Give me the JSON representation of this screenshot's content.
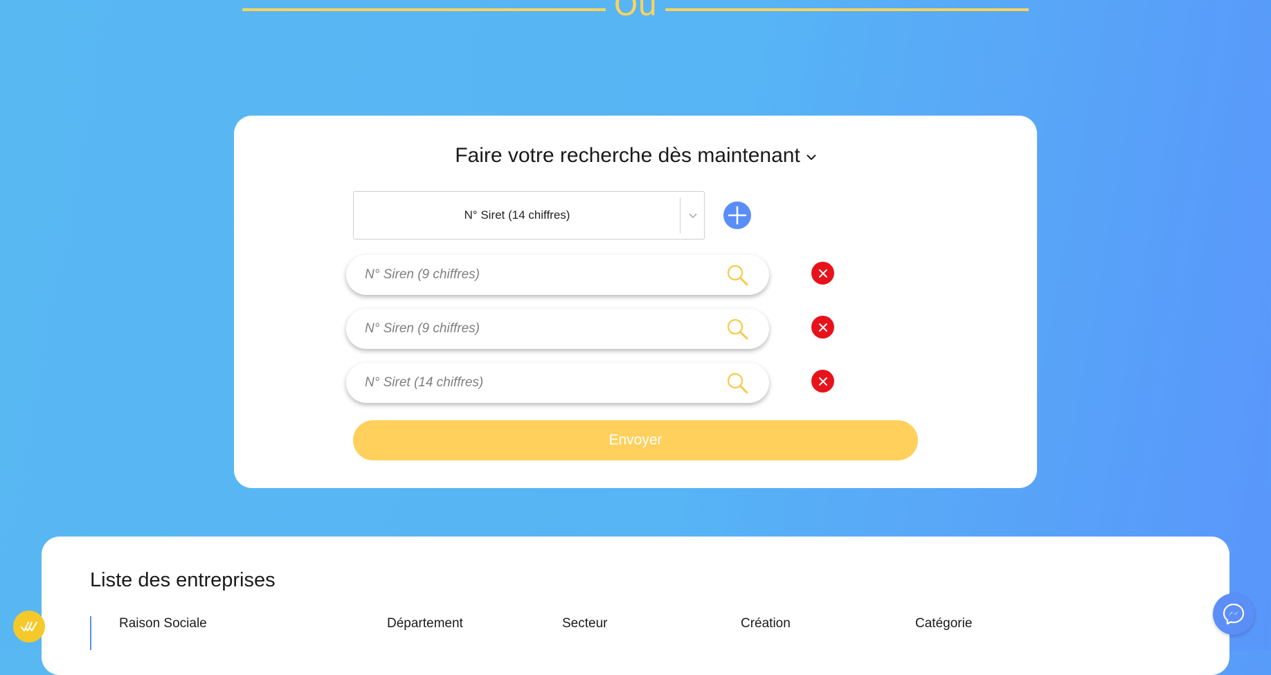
{
  "divider": {
    "text": "Ou"
  },
  "search": {
    "heading": "Faire votre recherche dès maintenant",
    "heading_chevron_icon": "chevron-down-icon",
    "type_select": {
      "value": "N° Siret (14 chiffres)"
    },
    "add_icon": "plus-icon",
    "fields": [
      {
        "placeholder": "N° Siren (9 chiffres)",
        "icon": "search-icon",
        "remove_icon": "close-icon"
      },
      {
        "placeholder": "N° Siren (9 chiffres)",
        "icon": "search-icon",
        "remove_icon": "close-icon"
      },
      {
        "placeholder": "N° Siret (14 chiffres)",
        "icon": "search-icon",
        "remove_icon": "close-icon"
      }
    ],
    "submit_label": "Envoyer"
  },
  "company_list": {
    "title": "Liste des entreprises",
    "columns": [
      "Raison Sociale",
      "Département",
      "Secteur",
      "Création",
      "Catégorie"
    ]
  },
  "widgets": {
    "chat_icon": "messenger-icon",
    "accessibility_icon": "accessibility-icon"
  },
  "colors": {
    "accent_yellow": "#ffd05c",
    "accent_blue": "#5a8ef7",
    "remove_red": "#e8121b",
    "background_start": "#58b8f2",
    "background_end": "#5996fb"
  }
}
